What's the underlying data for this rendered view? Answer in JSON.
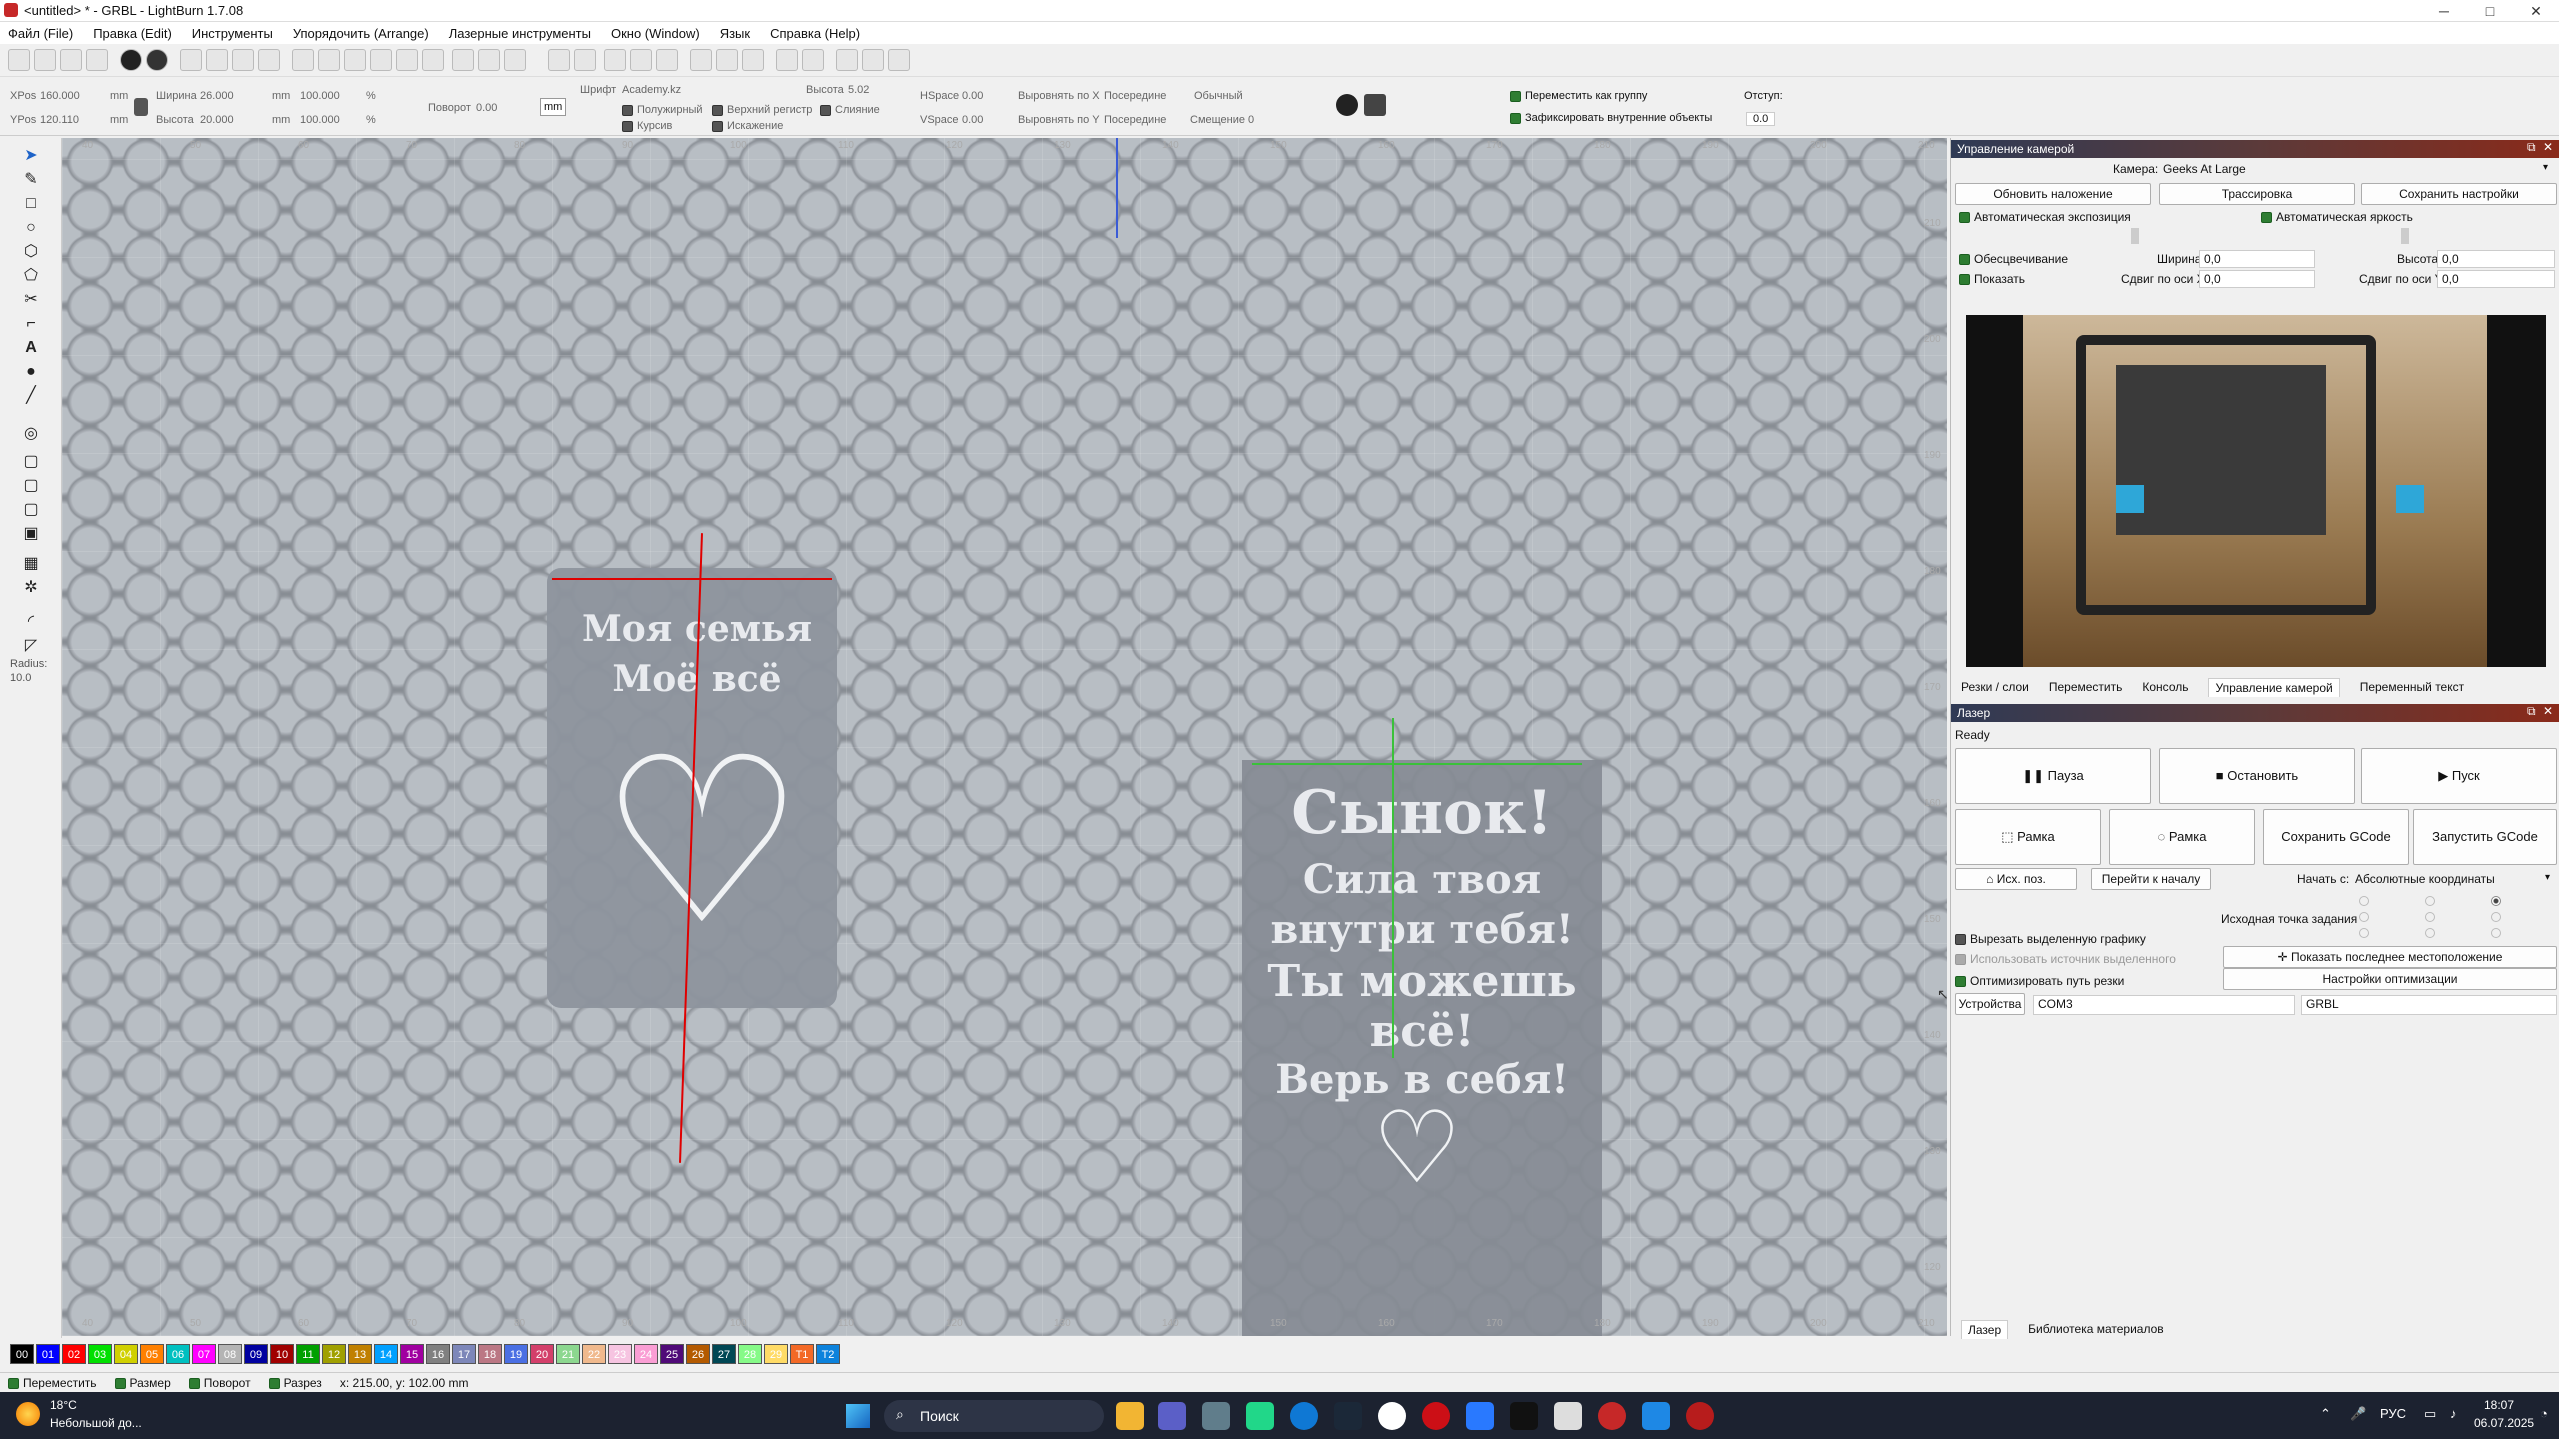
{
  "window": {
    "title": "<untitled> * - GRBL - LightBurn 1.7.08",
    "controls": [
      "─",
      "□",
      "✕"
    ]
  },
  "menu": [
    "Файл (File)",
    "Правка (Edit)",
    "Инструменты",
    "Упорядочить (Arrange)",
    "Лазерные инструменты",
    "Окно (Window)",
    "Язык",
    "Справка (Help)"
  ],
  "props": {
    "xpos_label": "XPos",
    "xpos": "160.000",
    "ypos_label": "YPos",
    "ypos": "120.110",
    "mm": "mm",
    "width_label": "Ширина",
    "width": "26.000",
    "height_label": "Высота",
    "height": "20.000",
    "scale_w": "100.000",
    "scale_h": "100.000",
    "pct": "%",
    "rotate_label": "Поворот",
    "rotate": "0.00",
    "units": "mm",
    "font_label": "Шрифт",
    "font": "Academy.kz",
    "font_h_label": "Высота",
    "font_h": "5.02",
    "hspace_label": "HSpace",
    "hspace": "0.00",
    "vspace_label": "VSpace",
    "vspace": "0.00",
    "alignx_label": "Выровнять по X",
    "alignx": "Посередине",
    "aligny_label": "Выровнять по Y",
    "aligny": "Посередине",
    "style": "Обычный",
    "offset_label": "Смещение",
    "offset": "0",
    "bold": "Полужирный",
    "italic": "Курсив",
    "upper": "Верхний регистр",
    "distort": "Искажение",
    "merge": "Слияние",
    "group_move": "Переместить как группу",
    "lock_inner": "Зафиксировать внутренние объекты",
    "indent_label": "Отступ:",
    "indent": "0.0"
  },
  "lefttools": {
    "radius_label": "Radius:",
    "radius": "10.0"
  },
  "canvas": {
    "tag1_line1": "Моя семья",
    "tag1_line2": "Моё всё",
    "tag2_lines": [
      "Сынок!",
      "Сила твоя",
      "внутри тебя!",
      "Ты можешь",
      "всё!",
      "Верь в себя!"
    ],
    "heart": "♡",
    "ruler_top": [
      "40",
      "50",
      "60",
      "70",
      "80",
      "90",
      "100",
      "110",
      "120",
      "130",
      "140",
      "150",
      "160",
      "170",
      "180",
      "190",
      "200",
      "210"
    ],
    "ruler_bottom": [
      "40",
      "50",
      "60",
      "70",
      "80",
      "90",
      "100",
      "110",
      "120",
      "130",
      "140",
      "150",
      "160",
      "170",
      "180",
      "190",
      "200",
      "210"
    ],
    "ruler_right": [
      "210",
      "200",
      "190",
      "180",
      "170",
      "160",
      "150",
      "140",
      "130",
      "120"
    ]
  },
  "camera": {
    "header": "Управление камерой",
    "camera_label": "Камера:",
    "camera": "Geeks At Large",
    "update": "Обновить наложение",
    "trace": "Трассировка",
    "save": "Сохранить настройки",
    "auto_exposure": "Автоматическая экспозиция",
    "auto_brightness": "Автоматическая яркость",
    "desaturate": "Обесцвечивание",
    "show": "Показать",
    "width_label": "Ширина",
    "width": "0,0",
    "height_label": "Высота",
    "height": "0,0",
    "shiftx_label": "Сдвиг по оси X",
    "shiftx": "0,0",
    "shifty_label": "Сдвиг по оси Y",
    "shifty": "0,0"
  },
  "panel_tabs": [
    "Резки / слои",
    "Переместить",
    "Консоль",
    "Управление камерой",
    "Переменный текст"
  ],
  "laser": {
    "header": "Лазер",
    "status": "Ready",
    "pause": "Пауза",
    "stop": "Остановить",
    "start": "Пуск",
    "frame1": "Рамка",
    "frame2": "Рамка",
    "save_gcode": "Сохранить GCode",
    "run_gcode": "Запустить GCode",
    "home": "Исх. поз.",
    "go_origin": "Перейти к началу",
    "start_from_label": "Начать с:",
    "start_from": "Абсолютные координаты",
    "job_origin": "Исходная точка задания",
    "cut_selected": "Вырезать выделенную графику",
    "use_selection_origin": "Использовать источник выделенного",
    "optimize": "Оптимизировать путь резки",
    "show_last": "Показать последнее местоположение",
    "opt_settings": "Настройки оптимизации",
    "devices": "Устройства",
    "port": "COM3",
    "device": "GRBL"
  },
  "bottom_tabs": [
    "Лазер",
    "Библиотека материалов"
  ],
  "palette": [
    {
      "label": "00",
      "color": "#000000"
    },
    {
      "label": "01",
      "color": "#0000ff"
    },
    {
      "label": "02",
      "color": "#ff0000"
    },
    {
      "label": "03",
      "color": "#00e000"
    },
    {
      "label": "04",
      "color": "#d0d000"
    },
    {
      "label": "05",
      "color": "#ff8000"
    },
    {
      "label": "06",
      "color": "#00c0c0"
    },
    {
      "label": "07",
      "color": "#ff00ff"
    },
    {
      "label": "08",
      "color": "#b4b4b4"
    },
    {
      "label": "09",
      "color": "#0000a0"
    },
    {
      "label": "10",
      "color": "#a00000"
    },
    {
      "label": "11",
      "color": "#00a000"
    },
    {
      "label": "12",
      "color": "#a0a000"
    },
    {
      "label": "13",
      "color": "#c08000"
    },
    {
      "label": "14",
      "color": "#00a0ff"
    },
    {
      "label": "15",
      "color": "#a000a0"
    },
    {
      "label": "16",
      "color": "#808080"
    },
    {
      "label": "17",
      "color": "#7d87b9"
    },
    {
      "label": "18",
      "color": "#bb7784"
    },
    {
      "label": "19",
      "color": "#4a6fe3"
    },
    {
      "label": "20",
      "color": "#d33f6a"
    },
    {
      "label": "21",
      "color": "#8cd78f"
    },
    {
      "label": "22",
      "color": "#f0b98d"
    },
    {
      "label": "23",
      "color": "#f6c4e1"
    },
    {
      "label": "24",
      "color": "#fa9ed4"
    },
    {
      "label": "25",
      "color": "#500a78"
    },
    {
      "label": "26",
      "color": "#b45a00"
    },
    {
      "label": "27",
      "color": "#004754"
    },
    {
      "label": "28",
      "color": "#86fa88"
    },
    {
      "label": "29",
      "color": "#ffdb66"
    },
    {
      "label": "T1",
      "color": "#f36926"
    },
    {
      "label": "T2",
      "color": "#0c82dc"
    }
  ],
  "status": {
    "move": "Переместить",
    "size": "Размер",
    "rotate": "Поворот",
    "cut": "Разрез",
    "coords": "x: 215.00, y: 102.00 mm"
  },
  "taskbar": {
    "temp": "18°C",
    "weather": "Небольшой до...",
    "search": "Поиск",
    "lang": "РУС",
    "time": "18:07",
    "date": "06.07.2025"
  }
}
